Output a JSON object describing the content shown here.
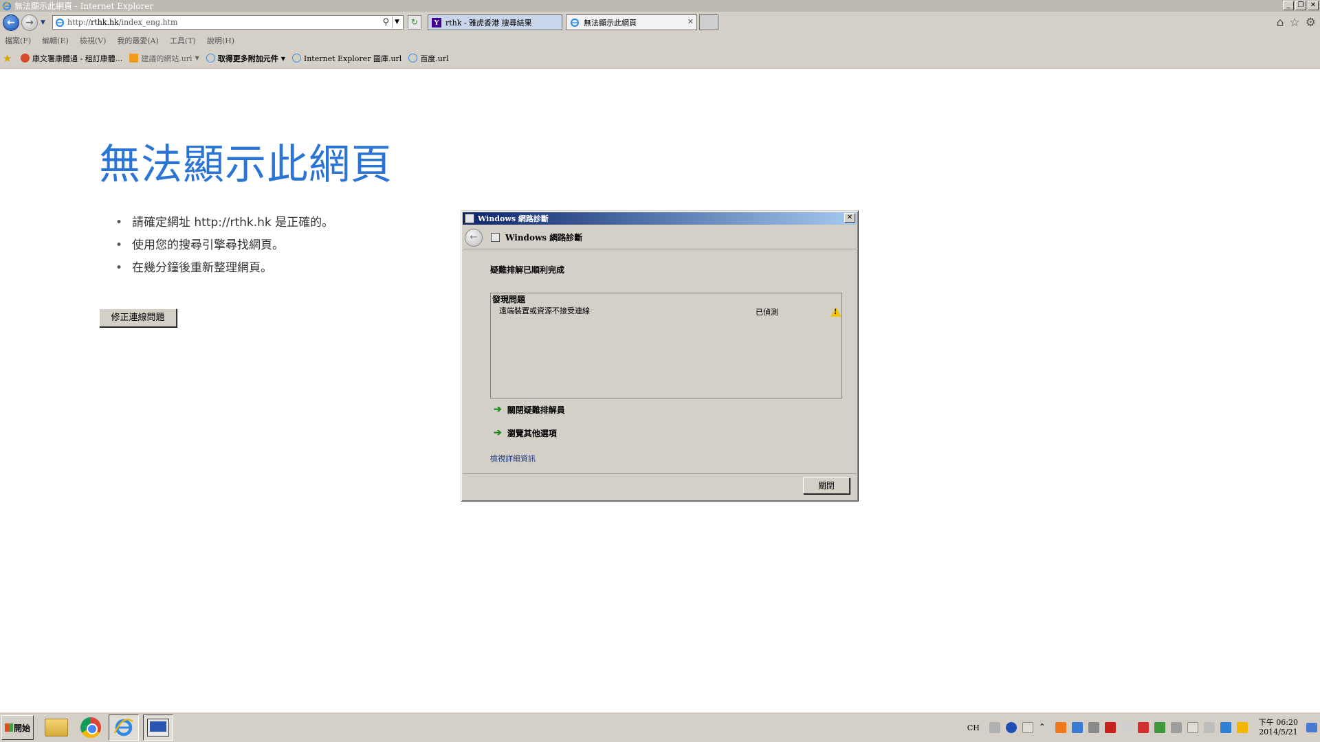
{
  "window": {
    "title": "無法顯示此網頁 - Internet Explorer"
  },
  "address_bar": {
    "url_prefix": "http://",
    "url_host": "rthk.hk",
    "url_path": "/index_eng.htm"
  },
  "tabs": [
    {
      "label": "rthk - 雅虎香港 搜尋結果",
      "icon": "yahoo-icon",
      "active": false
    },
    {
      "label": "無法顯示此網頁",
      "icon": "ie-page-icon",
      "active": true
    }
  ],
  "menu": [
    "檔案(F)",
    "編輯(E)",
    "檢視(V)",
    "我的最愛(A)",
    "工具(T)",
    "說明(H)"
  ],
  "favorites": [
    {
      "label": "康文署康體通 - 租訂康體...",
      "icon": "lcsd-icon",
      "style": "normal",
      "dropdown": false
    },
    {
      "label": "建議的網站.url",
      "icon": "suggested-sites-icon",
      "style": "muted",
      "dropdown": true
    },
    {
      "label": "取得更多附加元件",
      "icon": "addons-icon",
      "style": "bold",
      "dropdown": true
    },
    {
      "label": "Internet Explorer 圖庫.url",
      "icon": "ie-gallery-icon",
      "style": "normal",
      "dropdown": false
    },
    {
      "label": "百度.url",
      "icon": "baidu-icon",
      "style": "normal",
      "dropdown": false
    }
  ],
  "page": {
    "heading": "無法顯示此網頁",
    "bullets": [
      "請確定網址 http://rthk.hk 是正確的。",
      "使用您的搜尋引擎尋找網頁。",
      "在幾分鐘後重新整理網頁。"
    ],
    "fix_button": "修正連線問題"
  },
  "dialog": {
    "window_title": "Windows 網路診斷",
    "header_title": "Windows 網路診斷",
    "status": "疑難排解已順利完成",
    "issues_heading": "發現問題",
    "issue_name": "遠端裝置或資源不接受連線",
    "issue_status": "已偵測",
    "action_close": "關閉疑難排解員",
    "action_explore": "瀏覽其他選項",
    "detail_link": "檢視詳細資訊",
    "close_button": "關閉"
  },
  "taskbar": {
    "start_label": "開始",
    "apps": [
      "windows-explorer-icon",
      "chrome-icon",
      "internet-explorer-icon",
      "network-diagnostics-icon"
    ],
    "lang": "CH",
    "clock_time": "下午 06:20",
    "clock_date": "2014/5/21"
  },
  "colors": {
    "heading_blue": "#2a74d6",
    "dialog_title_start": "#0a246a",
    "dialog_title_end": "#a6caf0",
    "classic_gray": "#d4d0c8"
  }
}
